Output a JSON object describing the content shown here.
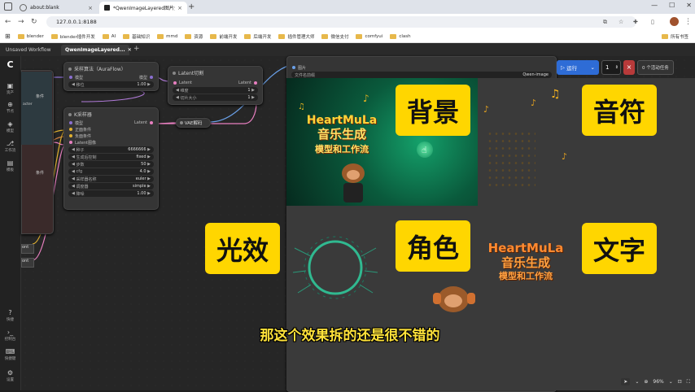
{
  "browser": {
    "tabs": [
      {
        "label": "about:blank"
      },
      {
        "label": "*QwenImageLayered图片分层"
      }
    ],
    "url": "127.0.0.1:8188",
    "bookmarks": [
      "blender",
      "blender插件开发",
      "AI",
      "基础知识",
      "mmd",
      "资源",
      "前端开发",
      "后端开发",
      "插件管理大师",
      "微信支付",
      "comfyui",
      "clash"
    ],
    "all_bookmarks": "所有书签"
  },
  "app": {
    "workflow_tabs": [
      "Unsaved Workflow",
      "QwenImageLayered..."
    ],
    "sidebar": [
      "资产",
      "节点",
      "模型",
      "工作流",
      "模板"
    ],
    "sidebar_bottom": [
      "快捷",
      "控制台",
      "快捷键",
      "设置"
    ],
    "run": {
      "label": "运行",
      "count": "1",
      "queue": "0 个活动任务"
    },
    "zoom": "96%",
    "nodes": {
      "sampling": {
        "title": "采样算法（AuraFlow）",
        "in": "模型",
        "out": "模型",
        "shift_label": "移位",
        "shift": "1.00"
      },
      "latent_cut": {
        "title": "Latent切割",
        "in": "Latent",
        "out": "Latent",
        "dim_label": "维度",
        "dim": "1",
        "size_label": "切片大小",
        "size": "1"
      },
      "ksampler": {
        "title": "K采样器",
        "out": "Latent",
        "inputs": [
          "模型",
          "正面条件",
          "负面条件",
          "Latent图像"
        ],
        "widgets": [
          {
            "k": "种子",
            "v": "6666666"
          },
          {
            "k": "生成后控制",
            "v": "fixed"
          },
          {
            "k": "步数",
            "v": "50"
          },
          {
            "k": "cfg",
            "v": "4.0"
          },
          {
            "k": "采样器名称",
            "v": "euler"
          },
          {
            "k": "调度器",
            "v": "simple"
          },
          {
            "k": "降噪",
            "v": "1.00"
          }
        ]
      },
      "vae": {
        "title": "VAE解码"
      },
      "left_labels": {
        "cond": "条件",
        "cond2": "条件",
        "extra": "acter"
      },
      "image_node": {
        "in": "图片",
        "prefix_label": "文件名前缀",
        "prefix": "Qwen-image"
      }
    },
    "tiles": [
      "背景",
      "音符",
      "光效",
      "角色",
      "文字"
    ],
    "poster": {
      "line1": "HeartMuLa",
      "line2": "音乐生成",
      "line3": "模型和工作流"
    },
    "subtitle": "那这个效果拆的还是很不错的",
    "left_edge": [
      "ont",
      "ont"
    ]
  }
}
